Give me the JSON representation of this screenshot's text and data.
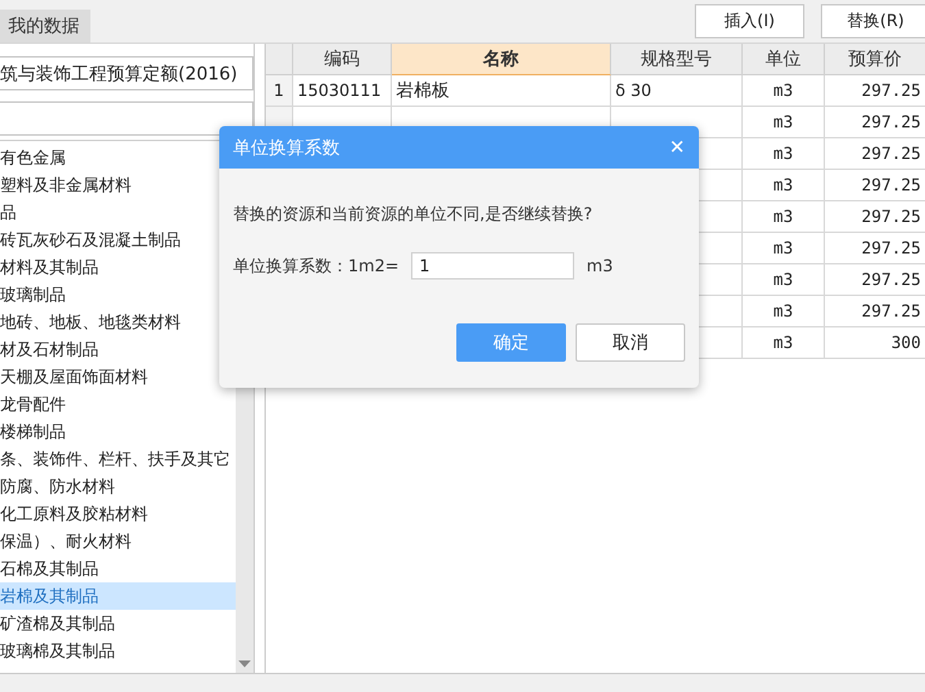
{
  "top_bar": {
    "tabs": [
      {
        "label": "我的数据",
        "selected": true
      }
    ],
    "buttons": [
      "插入(I)",
      "替换(R)"
    ]
  },
  "library": {
    "combo": "筑与装饰工程预算定额(2016)",
    "items": [
      {
        "label": "有色金属",
        "selected": false
      },
      {
        "label": "塑料及非金属材料",
        "selected": false
      },
      {
        "label": "品",
        "selected": false
      },
      {
        "label": "砖瓦灰砂石及混凝土制品",
        "selected": false
      },
      {
        "label": "材料及其制品",
        "selected": false
      },
      {
        "label": "玻璃制品",
        "selected": false
      },
      {
        "label": "地砖、地板、地毯类材料",
        "selected": false
      },
      {
        "label": "材及石材制品",
        "selected": false
      },
      {
        "label": "天棚及屋面饰面材料",
        "selected": false
      },
      {
        "label": "龙骨配件",
        "selected": false
      },
      {
        "label": "楼梯制品",
        "selected": false
      },
      {
        "label": "条、装饰件、栏杆、扶手及其它",
        "selected": false
      },
      {
        "label": "防腐、防水材料",
        "selected": false
      },
      {
        "label": "化工原料及胶粘材料",
        "selected": false
      },
      {
        "label": "保温）、耐火材料",
        "selected": false
      },
      {
        "label": "石棉及其制品",
        "selected": false
      },
      {
        "label": "岩棉及其制品",
        "selected": true
      },
      {
        "label": "矿渣棉及其制品",
        "selected": false
      },
      {
        "label": "玻璃棉及其制品",
        "selected": false
      }
    ]
  },
  "table": {
    "columns": [
      {
        "label": "编码",
        "selected": false
      },
      {
        "label": "名称",
        "selected": true
      },
      {
        "label": "规格型号",
        "selected": false
      },
      {
        "label": "单位",
        "selected": false
      },
      {
        "label": "预算价",
        "selected": false
      }
    ],
    "rows": [
      {
        "number": "1",
        "code": "15030111",
        "name": "岩棉板",
        "spec": "δ 30",
        "unit": "m3",
        "price": "297.25"
      },
      {
        "unit": "m3",
        "price": "297.25"
      },
      {
        "unit": "m3",
        "price": "297.25"
      },
      {
        "unit": "m3",
        "price": "297.25"
      },
      {
        "unit": "m3",
        "price": "297.25"
      },
      {
        "unit": "m3",
        "price": "297.25"
      },
      {
        "unit": "m3",
        "price": "297.25"
      },
      {
        "unit": "m3",
        "price": "297.25"
      },
      {
        "unit": "m3",
        "price": "300"
      }
    ]
  },
  "dialog": {
    "title": "单位换算系数",
    "close": "✕",
    "message": "替换的资源和当前资源的单位不同,是否继续替换?",
    "factor_label": "单位换算系数：1m2=",
    "factor_value": "1",
    "factor_unit": "m3",
    "buttons": [
      {
        "label": "确定",
        "kind": "primary"
      },
      {
        "label": "取消",
        "kind": "secondary"
      }
    ]
  }
}
